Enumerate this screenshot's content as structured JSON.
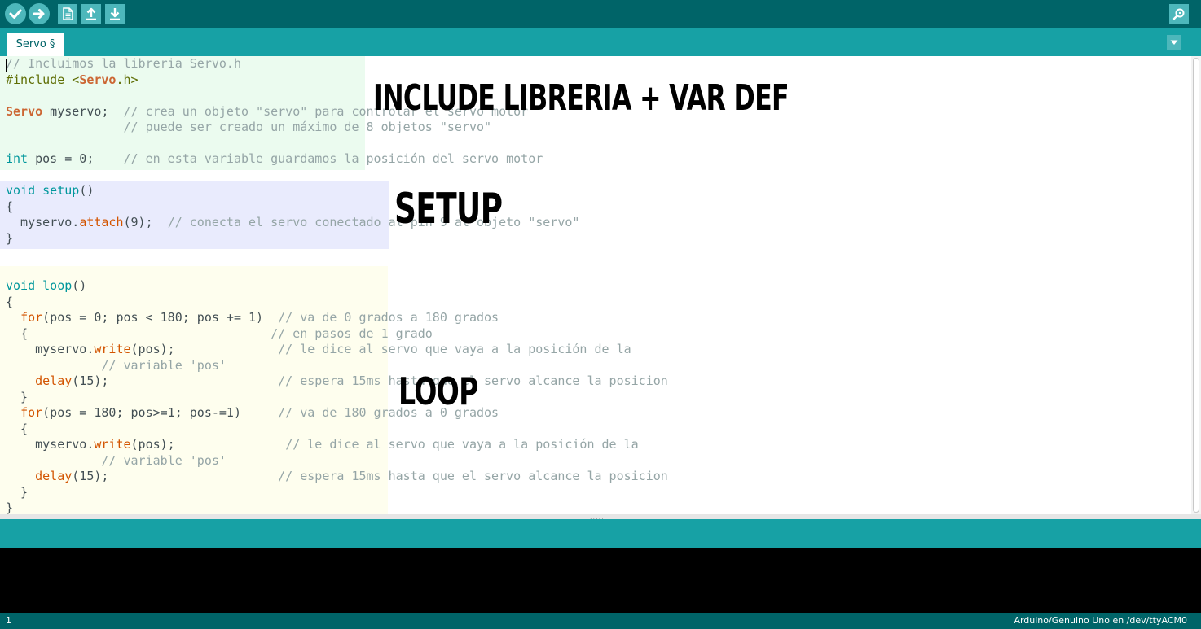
{
  "colors": {
    "toolbar_bg": "#006468",
    "tab_bar_bg": "#17a1a5",
    "button_bg": "#4db7bb",
    "region_include": "#ebfbef",
    "region_setup": "#e9ebfd",
    "region_loop": "#fefeee",
    "comment": "#95a5a6",
    "keyword": "#00979c",
    "function": "#d35400",
    "type": "#cc6633"
  },
  "toolbar": {
    "verify_icon": "checkmark-icon",
    "upload_icon": "arrow-right-icon",
    "new_icon": "document-icon",
    "open_icon": "arrow-up-icon",
    "save_icon": "arrow-down-icon",
    "serial_monitor_icon": "magnifier-icon"
  },
  "tabs": [
    {
      "label": "Servo §"
    }
  ],
  "code": {
    "lines": [
      [
        {
          "c": "cm",
          "t": "// Incluimos la libreria Servo.h"
        }
      ],
      [
        {
          "c": "pp",
          "t": "#include <"
        },
        {
          "c": "ty",
          "t": "Servo"
        },
        {
          "c": "pp",
          "t": ".h>"
        }
      ],
      [],
      [
        {
          "c": "ty",
          "t": "Servo"
        },
        {
          "c": "",
          "t": " myservo;  "
        },
        {
          "c": "cm",
          "t": "// crea un objeto \"servo\" para controlar el servo motor"
        }
      ],
      [
        {
          "c": "",
          "t": "                "
        },
        {
          "c": "cm",
          "t": "// puede ser creado un máximo de 8 objetos \"servo\""
        }
      ],
      [],
      [
        {
          "c": "kw",
          "t": "int"
        },
        {
          "c": "",
          "t": " pos = 0;    "
        },
        {
          "c": "cm",
          "t": "// en esta variable guardamos la posición del servo motor"
        }
      ],
      [],
      [
        {
          "c": "kw",
          "t": "void"
        },
        {
          "c": "",
          "t": " "
        },
        {
          "c": "kw",
          "t": "setup"
        },
        {
          "c": "",
          "t": "()"
        }
      ],
      [
        {
          "c": "",
          "t": "{"
        }
      ],
      [
        {
          "c": "",
          "t": "  myservo."
        },
        {
          "c": "fn",
          "t": "attach"
        },
        {
          "c": "",
          "t": "(9);  "
        },
        {
          "c": "cm",
          "t": "// conecta el servo conectado al pin 9 al objeto \"servo\""
        }
      ],
      [
        {
          "c": "",
          "t": "}"
        }
      ],
      [],
      [],
      [
        {
          "c": "kw",
          "t": "void"
        },
        {
          "c": "",
          "t": " "
        },
        {
          "c": "kw",
          "t": "loop"
        },
        {
          "c": "",
          "t": "()"
        }
      ],
      [
        {
          "c": "",
          "t": "{"
        }
      ],
      [
        {
          "c": "",
          "t": "  "
        },
        {
          "c": "fn",
          "t": "for"
        },
        {
          "c": "",
          "t": "(pos = 0; pos < 180; pos += 1)  "
        },
        {
          "c": "cm",
          "t": "// va de 0 grados a 180 grados"
        }
      ],
      [
        {
          "c": "",
          "t": "  {                                 "
        },
        {
          "c": "cm",
          "t": "// en pasos de 1 grado"
        }
      ],
      [
        {
          "c": "",
          "t": "    myservo."
        },
        {
          "c": "fn",
          "t": "write"
        },
        {
          "c": "",
          "t": "(pos);              "
        },
        {
          "c": "cm",
          "t": "// le dice al servo que vaya a la posición de la"
        }
      ],
      [
        {
          "c": "",
          "t": "             "
        },
        {
          "c": "cm",
          "t": "// variable 'pos'"
        }
      ],
      [
        {
          "c": "",
          "t": "    "
        },
        {
          "c": "fn",
          "t": "delay"
        },
        {
          "c": "",
          "t": "(15);                       "
        },
        {
          "c": "cm",
          "t": "// espera 15ms hasta que el servo alcance la posicion"
        }
      ],
      [
        {
          "c": "",
          "t": "  }"
        }
      ],
      [
        {
          "c": "",
          "t": "  "
        },
        {
          "c": "fn",
          "t": "for"
        },
        {
          "c": "",
          "t": "(pos = 180; pos>=1; pos-=1)     "
        },
        {
          "c": "cm",
          "t": "// va de 180 grados a 0 grados"
        }
      ],
      [
        {
          "c": "",
          "t": "  {"
        }
      ],
      [
        {
          "c": "",
          "t": "    myservo."
        },
        {
          "c": "fn",
          "t": "write"
        },
        {
          "c": "",
          "t": "(pos);               "
        },
        {
          "c": "cm",
          "t": "// le dice al servo que vaya a la posición de la"
        }
      ],
      [
        {
          "c": "",
          "t": "             "
        },
        {
          "c": "cm",
          "t": "// variable 'pos'"
        }
      ],
      [
        {
          "c": "",
          "t": "    "
        },
        {
          "c": "fn",
          "t": "delay"
        },
        {
          "c": "",
          "t": "(15);                       "
        },
        {
          "c": "cm",
          "t": "// espera 15ms hasta que el servo alcance la posicion"
        }
      ],
      [
        {
          "c": "",
          "t": "  }"
        }
      ],
      [
        {
          "c": "",
          "t": "}"
        }
      ]
    ]
  },
  "annotations": {
    "include": "INCLUDE LIBRERIA + VAR DEF",
    "setup": "SETUP",
    "loop": "LOOP"
  },
  "splitter_grip": ".....",
  "status": {
    "line": "1",
    "board": "Arduino/Genuino Uno en /dev/ttyACM0"
  }
}
